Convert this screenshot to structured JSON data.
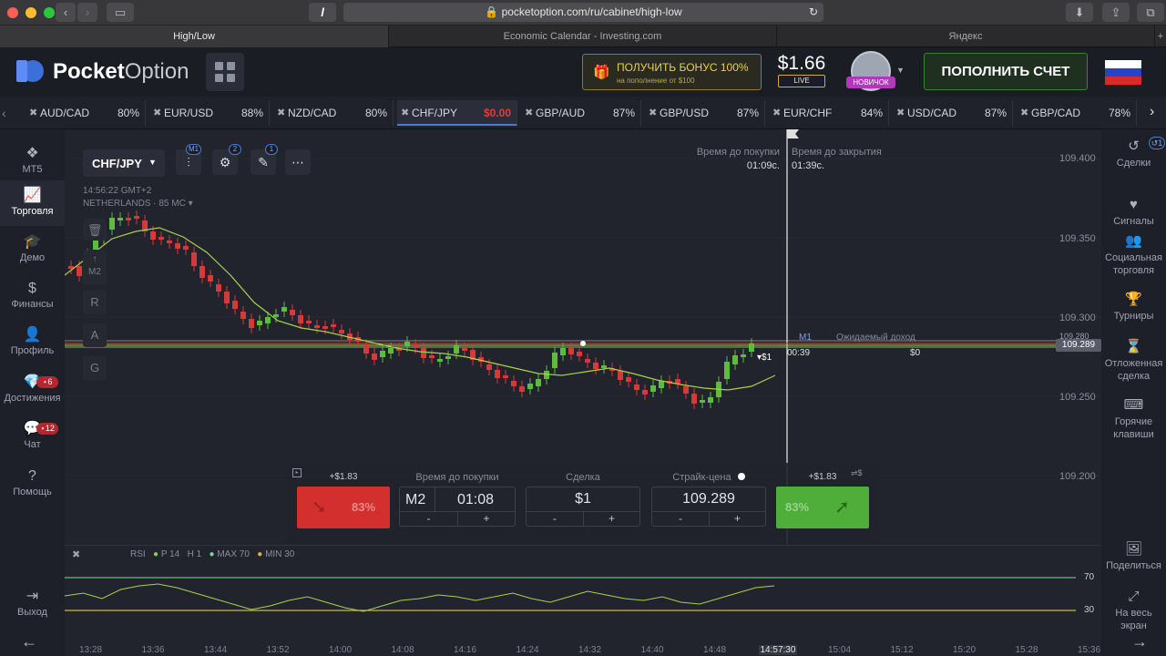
{
  "browser": {
    "url": "pocketoption.com/ru/cabinet/high-low",
    "tabs": [
      "High/Low",
      "Economic Calendar - Investing.com",
      "Яндекс"
    ]
  },
  "header": {
    "logo_a": "Pocket",
    "logo_b": "Option",
    "bonus_main": "ПОЛУЧИТЬ БОНУС 100%",
    "bonus_sub": "на пополнение от $100",
    "balance": "$1.66",
    "account_type": "LIVE",
    "user_badge": "НОВИЧОК",
    "deposit_button": "ПОПОЛНИТЬ СЧЕТ"
  },
  "assets": [
    {
      "name": "AUD/CAD",
      "payout": "80%"
    },
    {
      "name": "EUR/USD",
      "payout": "88%"
    },
    {
      "name": "NZD/CAD",
      "payout": "80%"
    },
    {
      "name": "CHF/JPY",
      "payout": "$0.00",
      "active": true
    },
    {
      "name": "GBP/AUD",
      "payout": "87%"
    },
    {
      "name": "GBP/USD",
      "payout": "87%"
    },
    {
      "name": "EUR/CHF",
      "payout": "84%"
    },
    {
      "name": "USD/CAD",
      "payout": "87%"
    },
    {
      "name": "GBP/CAD",
      "payout": "78%"
    }
  ],
  "left_nav": [
    {
      "label": "MT5",
      "icon": "mt5-icon"
    },
    {
      "label": "Торговля",
      "icon": "chart-icon"
    },
    {
      "label": "Демо",
      "icon": "graduation-cap-icon"
    },
    {
      "label": "Финансы",
      "icon": "dollar-icon"
    },
    {
      "label": "Профиль",
      "icon": "user-icon"
    },
    {
      "label": "Достижения",
      "icon": "diamond-icon",
      "badge": "6"
    },
    {
      "label": "Чат",
      "icon": "chat-icon",
      "badge": "12"
    },
    {
      "label": "Помощь",
      "icon": "help-icon"
    },
    {
      "label": "Выход",
      "icon": "exit-icon"
    }
  ],
  "right_nav": [
    {
      "label": "Сделки",
      "icon": "history-icon",
      "badge": "1"
    },
    {
      "label": "Сигналы",
      "icon": "heart-pulse-icon"
    },
    {
      "label": "Социальная торговля",
      "icon": "people-icon"
    },
    {
      "label": "Турниры",
      "icon": "trophy-icon"
    },
    {
      "label": "Отложенная сделка",
      "icon": "hourglass-icon"
    },
    {
      "label": "Горячие клавиши",
      "icon": "keyboard-icon"
    },
    {
      "label": "Поделиться",
      "icon": "image-icon"
    },
    {
      "label": "На весь экран",
      "icon": "fullscreen-icon"
    }
  ],
  "chart": {
    "pair": "CHF/JPY",
    "time": "14:56:22 GMT+2",
    "region": "NETHERLANDS",
    "ping": "85 MC",
    "timeframe_badge": "M1",
    "indicators_badge": "2",
    "drawings_badge": "1",
    "side_tools": [
      "M2",
      "R",
      "A",
      "G"
    ],
    "purchase_time_label": "Время до покупки",
    "purchase_time": "01:09c.",
    "close_time_label": "Время до закрытия",
    "close_time": "01:39c.",
    "current_price": "109.289",
    "price_ticks": [
      "109.400",
      "109.350",
      "109.300",
      "109.280",
      "109.250",
      "109.200"
    ],
    "timer_tf": "M1",
    "timer": "00:39",
    "expected_income_label": "Ожидаемый доход",
    "expected_income": "$0",
    "trade_marker": "$1",
    "time_ticks": [
      "13:28",
      "13:36",
      "13:44",
      "13:52",
      "14:00",
      "14:08",
      "14:16",
      "14:24",
      "14:32",
      "14:40",
      "14:48",
      "14:57:30",
      "15:04",
      "15:12",
      "15:20",
      "15:28",
      "15:36"
    ]
  },
  "trade": {
    "down_profit": "+$1.83",
    "down_pct": "83%",
    "time_label": "Время до покупки",
    "time_tf": "M2",
    "time_value": "01:08",
    "amount_label": "Сделка",
    "amount": "$1",
    "strike_label": "Страйк-цена",
    "strike": "109.289",
    "up_profit": "+$1.83",
    "up_pct": "83%",
    "minus": "-",
    "plus": "+"
  },
  "rsi": {
    "name": "RSI",
    "p": "P 14",
    "h": "H 1",
    "max": "MAX 70",
    "min": "MIN 30",
    "level_high": "70",
    "level_low": "30"
  }
}
